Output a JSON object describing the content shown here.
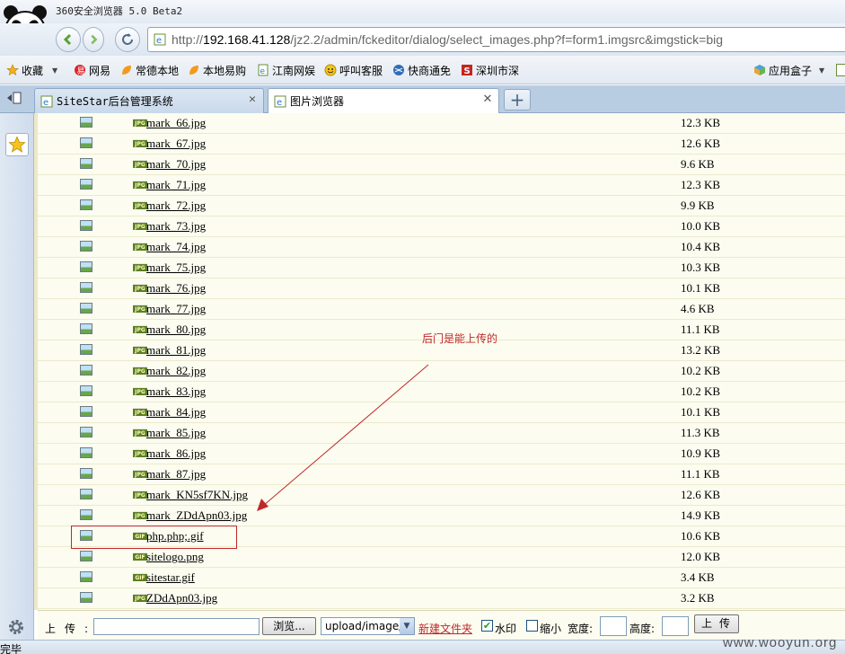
{
  "window": {
    "title": "360安全浏览器 5.0 Beta2"
  },
  "address_bar": {
    "scheme": "http://",
    "host": "192.168.41.128",
    "path": "/jz2.2/admin/fckeditor/dialog/select_images.php?f=form1.imgsrc&imgstick=big"
  },
  "bookmarks": {
    "favorites_label": "收藏",
    "items": [
      "网易",
      "常德本地",
      "本地易购",
      "江南网娱",
      "呼叫客服",
      "快商通免",
      "深圳市深"
    ],
    "app_box_label": "应用盒子"
  },
  "tabs": [
    {
      "label": "SiteStar后台管理系统",
      "active": false
    },
    {
      "label": "图片浏览器",
      "active": true
    }
  ],
  "files": [
    {
      "type": "jpg",
      "name": "mark_66.jpg",
      "size": "12.3 KB"
    },
    {
      "type": "jpg",
      "name": "mark_67.jpg",
      "size": "12.6 KB"
    },
    {
      "type": "jpg",
      "name": "mark_70.jpg",
      "size": "9.6 KB"
    },
    {
      "type": "jpg",
      "name": "mark_71.jpg",
      "size": "12.3 KB"
    },
    {
      "type": "jpg",
      "name": "mark_72.jpg",
      "size": "9.9 KB"
    },
    {
      "type": "jpg",
      "name": "mark_73.jpg",
      "size": "10.0 KB"
    },
    {
      "type": "jpg",
      "name": "mark_74.jpg",
      "size": "10.4 KB"
    },
    {
      "type": "jpg",
      "name": "mark_75.jpg",
      "size": "10.3 KB"
    },
    {
      "type": "jpg",
      "name": "mark_76.jpg",
      "size": "10.1 KB"
    },
    {
      "type": "jpg",
      "name": "mark_77.jpg",
      "size": "4.6 KB"
    },
    {
      "type": "jpg",
      "name": "mark_80.jpg",
      "size": "11.1 KB"
    },
    {
      "type": "jpg",
      "name": "mark_81.jpg",
      "size": "13.2 KB"
    },
    {
      "type": "jpg",
      "name": "mark_82.jpg",
      "size": "10.2 KB"
    },
    {
      "type": "jpg",
      "name": "mark_83.jpg",
      "size": "10.2 KB"
    },
    {
      "type": "jpg",
      "name": "mark_84.jpg",
      "size": "10.1 KB"
    },
    {
      "type": "jpg",
      "name": "mark_85.jpg",
      "size": "11.3 KB"
    },
    {
      "type": "jpg",
      "name": "mark_86.jpg",
      "size": "10.9 KB"
    },
    {
      "type": "jpg",
      "name": "mark_87.jpg",
      "size": "11.1 KB"
    },
    {
      "type": "jpg",
      "name": "mark_KN5sf7KN.jpg",
      "size": "12.6 KB"
    },
    {
      "type": "jpg",
      "name": "mark_ZDdApn03.jpg",
      "size": "14.9 KB"
    },
    {
      "type": "gif",
      "name": "php.php;.gif",
      "size": "10.6 KB"
    },
    {
      "type": "gif",
      "name": "sitelogo.png",
      "size": "12.0 KB"
    },
    {
      "type": "gif",
      "name": "sitestar.gif",
      "size": "3.4 KB"
    },
    {
      "type": "jpg",
      "name": "ZDdApn03.jpg",
      "size": "3.2 KB"
    }
  ],
  "annotation": {
    "text": "后门是能上传的",
    "color": "#c0282a"
  },
  "upload": {
    "label": "上传:",
    "browse_label": "浏览...",
    "folder_value": "upload/image/",
    "new_folder_label": "新建文件夹",
    "watermark_label": "水印",
    "watermark_checked": true,
    "thumbnail_label": "缩小",
    "thumbnail_checked": false,
    "width_label": "宽度:",
    "height_label": "高度:",
    "submit_label": "上传"
  },
  "status": {
    "text": "完毕"
  },
  "site_watermark": "www.wooyun.org",
  "colors": {
    "content_bg": "#fcfdf0",
    "accent_red": "#c0282a",
    "tab_bar": "#b9cde2"
  }
}
